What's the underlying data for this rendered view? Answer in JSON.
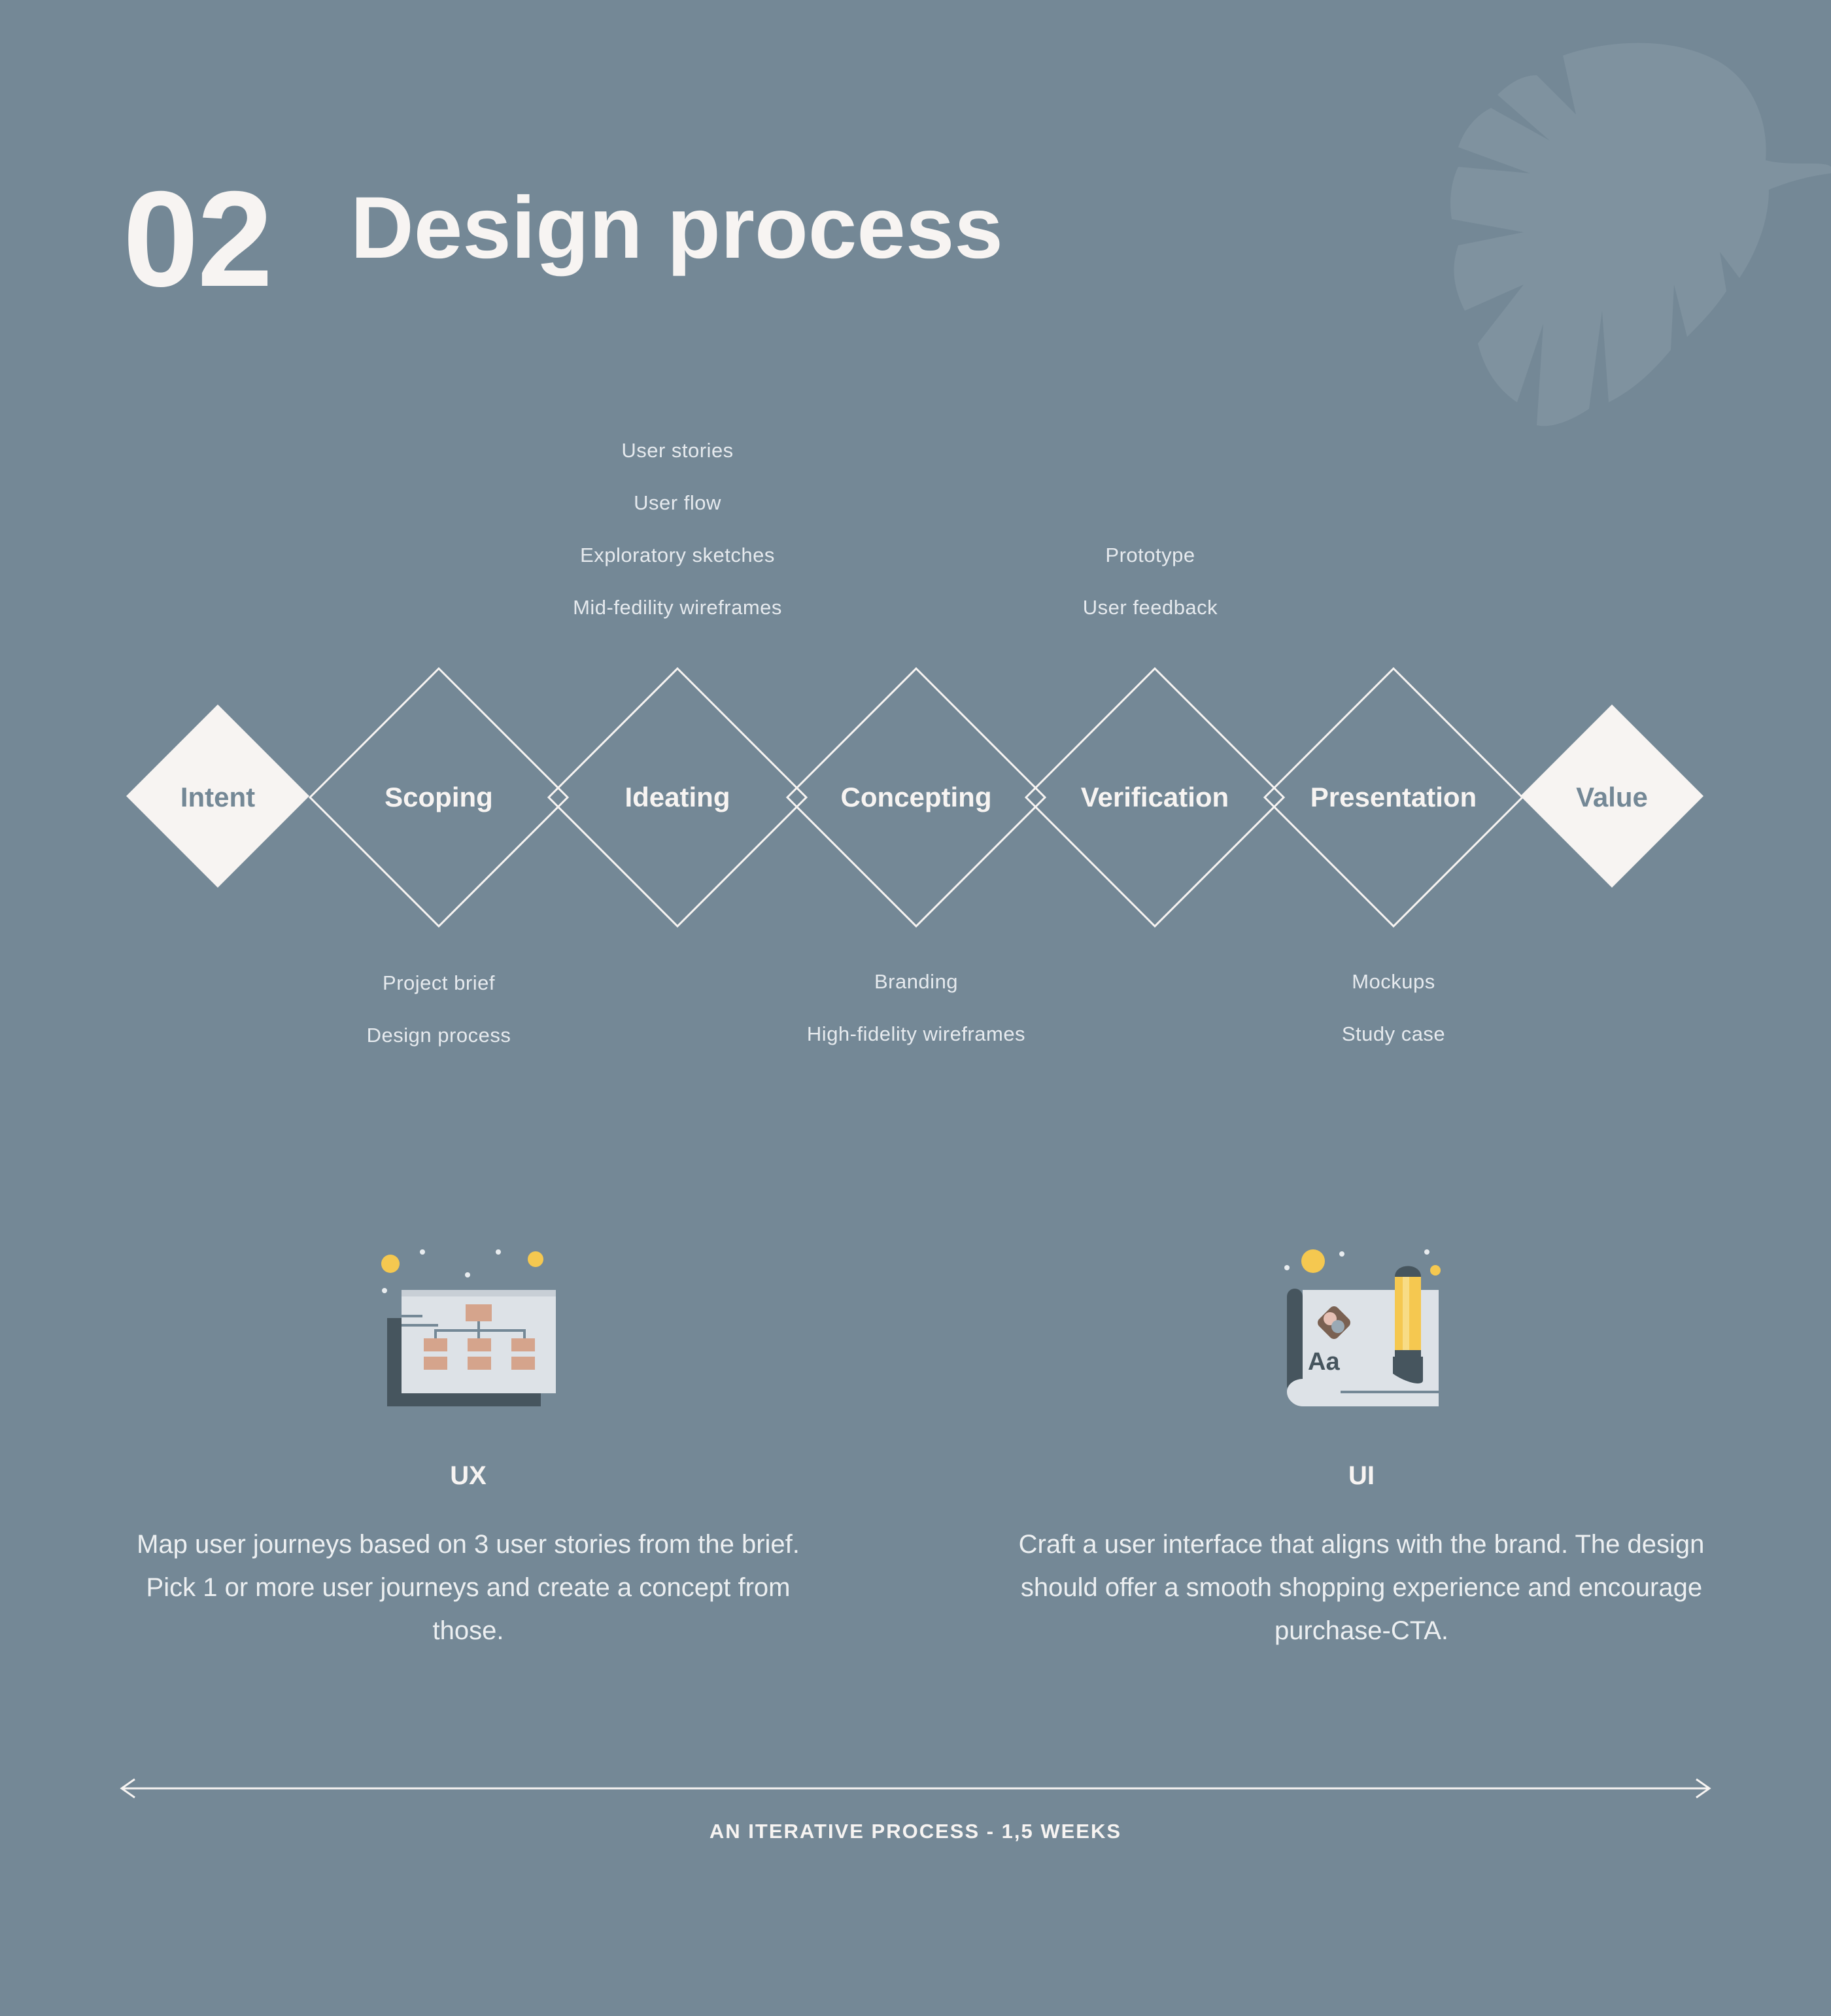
{
  "header": {
    "number": "02",
    "title": "Design process"
  },
  "colors": {
    "background": "#748896",
    "leaf": "#7f929f",
    "text": "#f7f4f2",
    "accent_orange": "#d5a48c",
    "accent_yellow": "#f5c850",
    "dark": "#46555e"
  },
  "process": {
    "stages": [
      {
        "label": "Intent",
        "style": "filled"
      },
      {
        "label": "Scoping",
        "style": "outline"
      },
      {
        "label": "Ideating",
        "style": "outline"
      },
      {
        "label": "Concepting",
        "style": "outline"
      },
      {
        "label": "Verification",
        "style": "outline"
      },
      {
        "label": "Presentation",
        "style": "outline"
      },
      {
        "label": "Value",
        "style": "filled"
      }
    ],
    "notes_above": {
      "ideating": [
        "User stories",
        "User flow",
        "Exploratory sketches",
        "Mid-fedility wireframes"
      ],
      "verification": [
        "Prototype",
        "User feedback"
      ]
    },
    "notes_below": {
      "scoping": [
        "Project brief",
        "Design process"
      ],
      "concepting": [
        "Branding",
        "High-fidelity wireframes"
      ],
      "presentation": [
        "Mockups",
        "Study case"
      ]
    }
  },
  "cards": {
    "ux": {
      "icon": "sitemap-icon",
      "title": "UX",
      "body": "Map user journeys based on 3 user stories from the brief. Pick 1 or more user journeys and create a concept from those."
    },
    "ui": {
      "icon": "design-canvas-icon",
      "icon_text": "Aa",
      "title": "UI",
      "body": "Craft a user interface that aligns with the brand. The design should offer a smooth shopping experience and encourage purchase-CTA."
    }
  },
  "timeline": {
    "label": "AN ITERATIVE PROCESS - 1,5 WEEKS"
  }
}
